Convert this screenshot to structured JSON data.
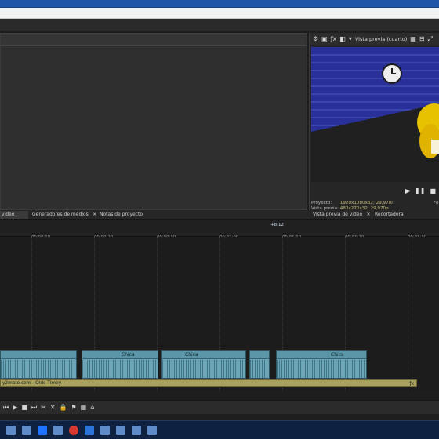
{
  "preview": {
    "title": "Vista previa (cuarto)",
    "info": {
      "project_label": "Proyecto:",
      "project_value": "1920x1080x32; 29,970i",
      "preview_label": "Vista previa:",
      "preview_value": "480x270x32; 29,970p",
      "right_partial": "Fo"
    }
  },
  "tabs": [
    {
      "label": "video",
      "active": true
    },
    {
      "label": "Generadores de medios",
      "active": false
    },
    {
      "label": "Notas de proyecto",
      "active": false
    },
    {
      "label": "Vista previa de video",
      "active": false
    },
    {
      "label": "Recortadora",
      "active": false
    }
  ],
  "timeline": {
    "cursor_time": "+8:12",
    "ruler": [
      "00:00:10",
      "00:00:20",
      "00:00:30",
      "00:01:00",
      "00:01:10",
      "00:01:20",
      "00:01:30"
    ],
    "clips": [
      {
        "label": "Chica"
      },
      {
        "label": "Chica"
      },
      {
        "label": "Chica"
      }
    ],
    "yt_track_title": "y2mate.com - Olde Timey"
  },
  "taskbar": [
    "start",
    "cortana",
    "vegas",
    "windows",
    "record",
    "photoshop",
    "app",
    "film",
    "settings",
    "chrome"
  ]
}
